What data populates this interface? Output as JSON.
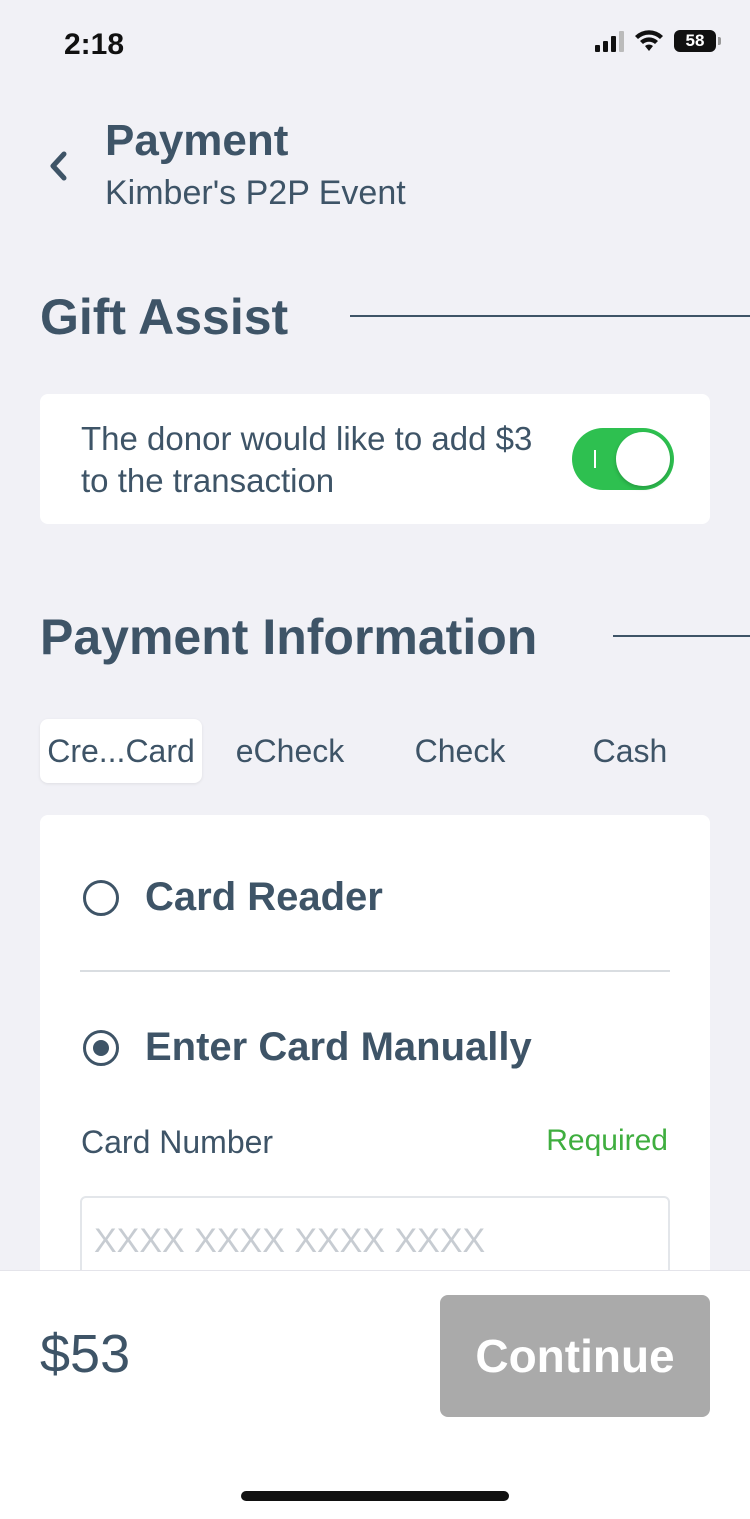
{
  "status_bar": {
    "time": "2:18",
    "battery": "58"
  },
  "header": {
    "title": "Payment",
    "subtitle": "Kimber's P2P Event"
  },
  "gift_assist": {
    "title": "Gift Assist",
    "text": "The donor would like to add $3 to the transaction",
    "toggle_on": true,
    "toggle_color": "#2ec050"
  },
  "payment_info": {
    "title": "Payment Information",
    "tabs": [
      {
        "label": "Cre...Card",
        "active": true
      },
      {
        "label": "eCheck",
        "active": false
      },
      {
        "label": "Check",
        "active": false
      },
      {
        "label": "Cash",
        "active": false
      }
    ],
    "options": [
      {
        "label": "Card Reader",
        "selected": false
      },
      {
        "label": "Enter Card Manually",
        "selected": true
      }
    ],
    "card_number": {
      "label": "Card Number",
      "required": "Required",
      "placeholder": "XXXX XXXX XXXX XXXX",
      "value": ""
    }
  },
  "footer": {
    "total": "$53",
    "continue_label": "Continue",
    "continue_color": "#aaaaaa"
  }
}
